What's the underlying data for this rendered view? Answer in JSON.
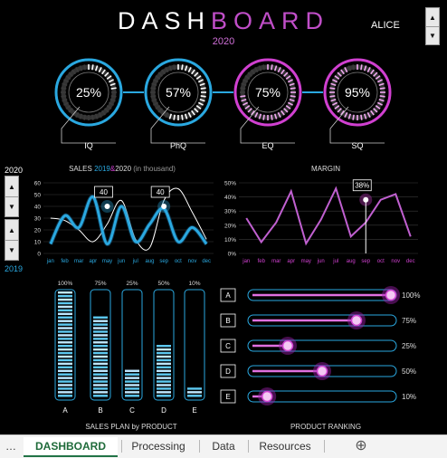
{
  "header": {
    "title_part1": "DASH",
    "title_part2": "BOARD",
    "year": "2020",
    "user": "ALICE"
  },
  "gauges": [
    {
      "label": "IQ",
      "value_text": "25%",
      "value": 25
    },
    {
      "label": "PhQ",
      "value_text": "57%",
      "value": 57
    },
    {
      "label": "EQ",
      "value_text": "75%",
      "value": 75
    },
    {
      "label": "SQ",
      "value_text": "95%",
      "value": 95
    }
  ],
  "left_panel": {
    "year_top": "2020",
    "year_bottom": "2019"
  },
  "chart_data": [
    {
      "type": "line",
      "title_prefix": "SALES ",
      "title_year_a": "2019",
      "title_sep": "&",
      "title_year_b": "2020",
      "title_suffix": " (in thousand)",
      "categories": [
        "jan",
        "feb",
        "mar",
        "apr",
        "may",
        "jun",
        "jul",
        "aug",
        "sep",
        "oct",
        "nov",
        "dec"
      ],
      "ylim": [
        0,
        60
      ],
      "yticks": [
        "0",
        "10",
        "20",
        "30",
        "40",
        "50",
        "60"
      ],
      "series": [
        {
          "name": "2019",
          "values": [
            30,
            28,
            20,
            10,
            25,
            45,
            12,
            5,
            45,
            55,
            35,
            12
          ]
        },
        {
          "name": "2020",
          "values": [
            8,
            32,
            22,
            48,
            8,
            40,
            10,
            25,
            38,
            10,
            22,
            8
          ]
        }
      ],
      "callouts": [
        {
          "category": "may",
          "value": 40,
          "label": "40"
        },
        {
          "category": "sep",
          "value": 40,
          "label": "40"
        }
      ]
    },
    {
      "type": "line",
      "title": "MARGIN",
      "categories": [
        "jan",
        "feb",
        "mar",
        "apr",
        "may",
        "jun",
        "jul",
        "aug",
        "sep",
        "oct",
        "nov",
        "dec"
      ],
      "ylim": [
        0,
        50
      ],
      "yticks": [
        "0%",
        "10%",
        "20%",
        "30%",
        "40%",
        "50%"
      ],
      "series": [
        {
          "values": [
            25,
            8,
            22,
            44,
            7,
            24,
            46,
            12,
            22,
            38,
            42,
            12
          ]
        }
      ],
      "callouts": [
        {
          "category": "sep",
          "value": 38,
          "label": "38%"
        }
      ]
    },
    {
      "type": "bar",
      "title": "SALES PLAN by PRODUCT",
      "categories": [
        "A",
        "B",
        "C",
        "D",
        "E"
      ],
      "value_labels": [
        "100%",
        "75%",
        "25%",
        "50%",
        "10%"
      ],
      "values": [
        100,
        75,
        25,
        50,
        10
      ],
      "ylim": [
        0,
        100
      ]
    },
    {
      "type": "bar",
      "title": "PRODUCT RANKING",
      "categories": [
        "A",
        "B",
        "C",
        "D",
        "E"
      ],
      "value_labels": [
        "100%",
        "75%",
        "25%",
        "50%",
        "10%"
      ],
      "values": [
        100,
        75,
        25,
        50,
        10
      ],
      "xlim": [
        0,
        100
      ]
    }
  ],
  "tabs": {
    "items": [
      "DASHBOARD",
      "Processing",
      "Data",
      "Resources"
    ],
    "active": "DASHBOARD"
  },
  "colors": {
    "blue": "#2aa8e0",
    "pink": "#d040d0",
    "white": "#ffffff",
    "purple_text": "#c04ec8",
    "tab_green": "#217346"
  }
}
